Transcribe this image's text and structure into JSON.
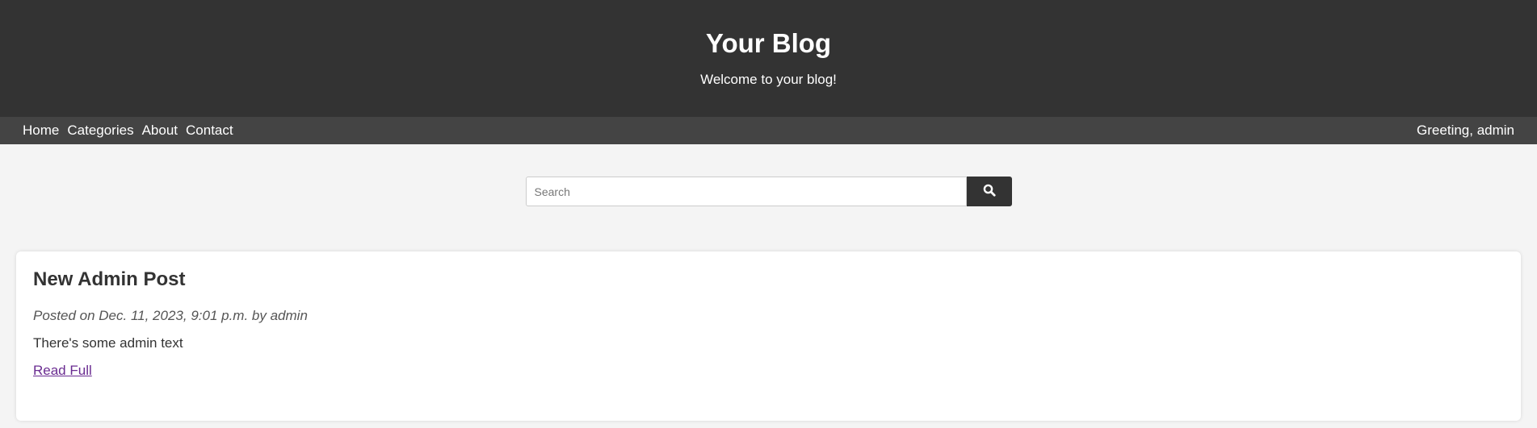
{
  "header": {
    "title": "Your Blog",
    "tagline": "Welcome to your blog!"
  },
  "nav": {
    "links": [
      "Home",
      "Categories",
      "About",
      "Contact"
    ],
    "greeting": "Greeting, admin"
  },
  "search": {
    "placeholder": "Search",
    "value": "",
    "button_icon": "search-icon"
  },
  "posts": [
    {
      "title": "New Admin Post",
      "meta": "Posted on Dec. 11, 2023, 9:01 p.m. by admin",
      "excerpt": "There's some admin text",
      "read_more": "Read Full"
    }
  ],
  "colors": {
    "header_bg": "#333333",
    "nav_bg": "#444444",
    "page_bg": "#f4f4f4",
    "link_visited": "#6a2c91"
  }
}
